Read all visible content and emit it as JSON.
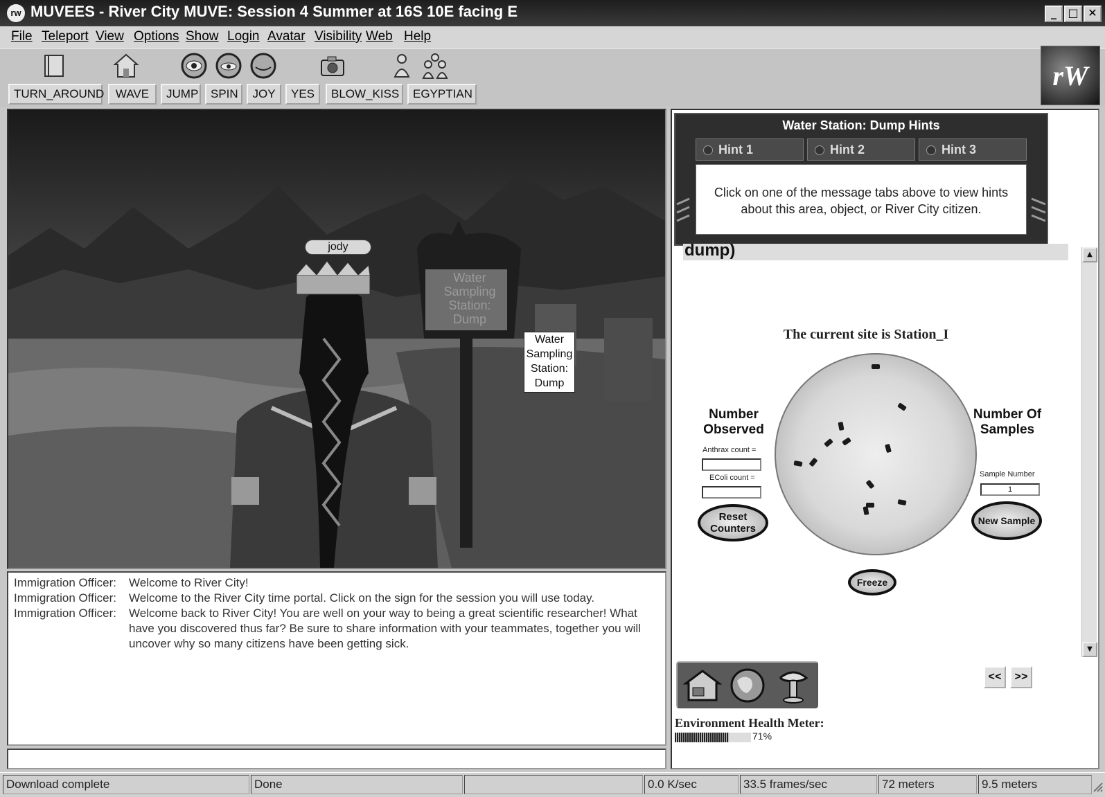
{
  "window": {
    "title": "MUVEES - River City MUVE: Session 4 Summer at 16S 10E facing E",
    "logo_text": "rw",
    "controls": [
      "minimize",
      "maximize",
      "close"
    ]
  },
  "menu": [
    "File",
    "Teleport",
    "View",
    "Options",
    "Show",
    "Login",
    "Avatar",
    "Visibility",
    "Web",
    "Help"
  ],
  "toolbar": {
    "icons": [
      "notebook-icon",
      "home-icon",
      "eye-first-person-icon",
      "eye-over-shoulder-icon",
      "eye-overhead-icon",
      "camera-icon",
      "single-avatar-icon",
      "group-avatars-icon"
    ],
    "brand_logo": "rW"
  },
  "emotes": [
    "TURN_AROUND",
    "WAVE",
    "JUMP",
    "SPIN",
    "JOY",
    "YES",
    "BLOW_KISS",
    "EGYPTIAN"
  ],
  "scene": {
    "avatar_name": "jody",
    "sign_board_text": "Water\nSampling\nStation:\nDump",
    "sign_label": "Water\nSampling\nStation:\nDump"
  },
  "chat": [
    {
      "speaker": "Immigration Officer:",
      "message": "Welcome to River City!"
    },
    {
      "speaker": "Immigration Officer:",
      "message": "Welcome to the River City time portal. Click on the sign for the session you will use today."
    },
    {
      "speaker": "Immigration Officer:",
      "message": "Welcome back to River City! You are well on your way to being a great scientific researcher! What have you discovered thus far?  Be sure to share information with your teammates, together you will uncover why so many citizens have been getting sick."
    }
  ],
  "hints": {
    "title": "Water Station: Dump Hints",
    "tabs": [
      "Hint 1",
      "Hint 2",
      "Hint 3"
    ],
    "body": "Click on one of the message tabs above to view hints about this area, object, or River City citizen."
  },
  "sample_panel": {
    "heading_fragment": "dump)",
    "site_title": "The current site is Station_I",
    "observed_heading": "Number\nObserved",
    "anthrax_label": "Anthrax count =",
    "anthrax_value": "",
    "ecoli_label": "EColi count =",
    "ecoli_value": "",
    "reset_button": "Reset\nCounters",
    "samples_heading": "Number Of\nSamples",
    "sample_number_label": "Sample Number",
    "sample_number_value": "1",
    "new_sample_button": "New Sample",
    "freeze_button": "Freeze"
  },
  "navigation": {
    "icons": [
      "house-icon",
      "globe-icon",
      "microscope-icon"
    ],
    "prev_label": "<<",
    "next_label": ">>"
  },
  "health_meter": {
    "label": "Environment Health Meter:",
    "percent_text": "71%",
    "fraction": 0.71
  },
  "status_bar": [
    "Download complete",
    "Done",
    "",
    "0.0 K/sec",
    "33.5 frames/sec",
    "72 meters",
    "9.5 meters"
  ]
}
